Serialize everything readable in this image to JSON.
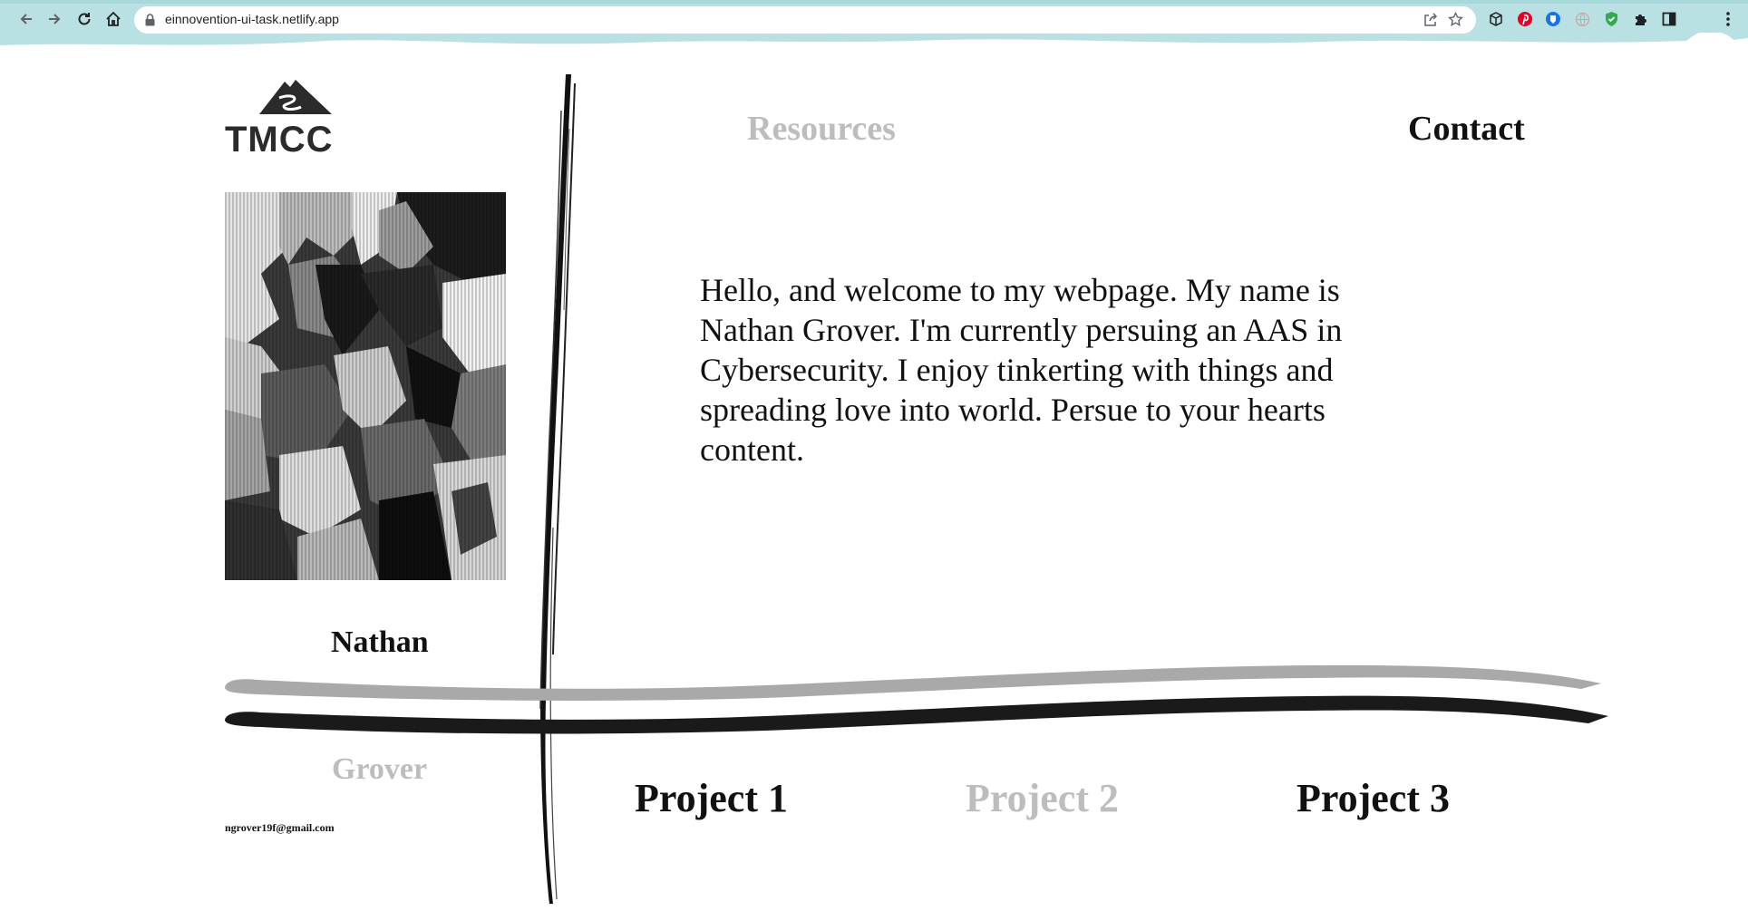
{
  "browser": {
    "url": "einnovention-ui-task.netlify.app",
    "icons": [
      "back-arrow-icon",
      "forward-arrow-icon",
      "reload-icon",
      "home-icon",
      "lock-icon",
      "share-icon",
      "star-icon",
      "extension-cube-icon",
      "pinterest-icon",
      "shield-icon",
      "globe-icon",
      "shield-check-icon",
      "puzzle-icon",
      "sidebar-icon",
      "menu-dots-icon"
    ]
  },
  "site": {
    "logo_text": "TMCC",
    "nav": {
      "resources": "Resources",
      "contact": "Contact"
    },
    "profile": {
      "first_name": "Nathan",
      "last_name": "Grover",
      "email": "ngrover19f@gmail.com"
    },
    "bio": "Hello, and welcome to my webpage. My name is Nathan Grover. I'm currently persuing an AAS in Cybersecurity. I enjoy tinkerting with things and spreading love into world. Persue to your hearts content.",
    "projects": [
      "Project 1",
      "Project 2",
      "Project 3"
    ]
  },
  "colors": {
    "chrome": "#b9e1e3",
    "text_dark": "#111111",
    "text_light": "#bdbdbd",
    "stroke_grey": "#a9a9a9",
    "stroke_black": "#1a1a1a"
  }
}
